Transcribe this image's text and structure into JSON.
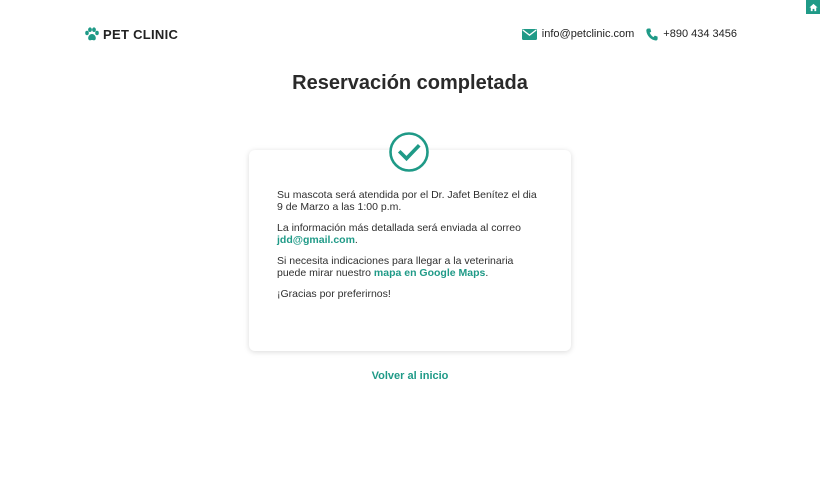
{
  "header": {
    "brand": "PET CLINIC",
    "email": "info@petclinic.com",
    "phone": "+890 434 3456"
  },
  "title": "Reservación completada",
  "card": {
    "line1": "Su mascota será atendida por el Dr. Jafet Benítez el dia 9 de Marzo a las 1:00 p.m.",
    "line2_prefix": "La información más detallada será enviada al correo ",
    "email_link": "jdd@gmail.com",
    "line2_suffix": ".",
    "line3_prefix": "Si necesita indicaciones para llegar a la veterinaria puede mirar nuestro ",
    "maps_link": "mapa en Google Maps",
    "line3_suffix": ".",
    "thanks": "¡Gracias por preferirnos!"
  },
  "back_link": "Volver al inicio",
  "colors": {
    "accent": "#1f9a87"
  },
  "icons": {
    "home": "home-icon",
    "brand": "paw-icon",
    "email": "envelope-icon",
    "phone": "phone-icon",
    "status": "check-circle-icon"
  }
}
